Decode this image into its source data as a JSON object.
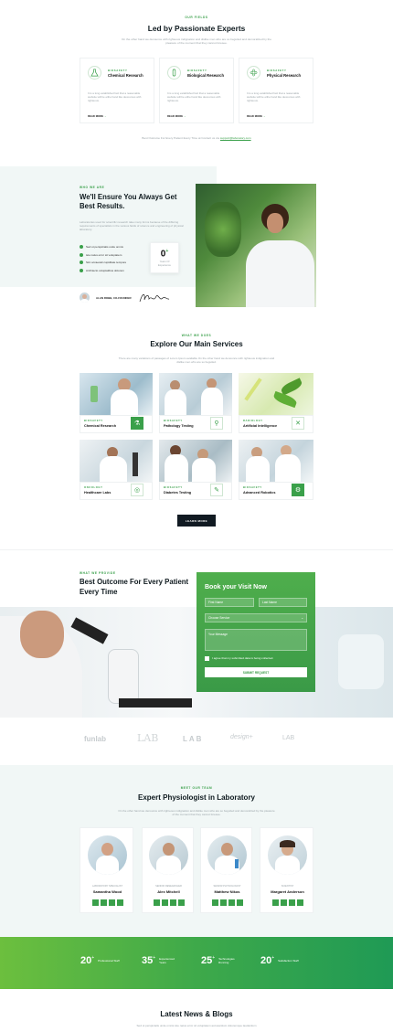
{
  "hero": {
    "eyebrow": "our fields",
    "title": "Led by Passionate Experts",
    "subtitle": "On the other hand we denounce with righteous indignation and dislike men who are so beguiled and demoralized by the pleasure of the moment that they cannot foresee.",
    "cards": [
      {
        "tag": "BIOSAFETY",
        "title": "Chemical Research",
        "text": "It is a long established fact that a reasonable website will be eithe hand like devourous with righteous.",
        "link": "READ MORE"
      },
      {
        "tag": "BIOSAFETY",
        "title": "Biological Research",
        "text": "It is a long established fact that a reasonable website will be eithe hand like devourous with righteous.",
        "link": "READ MORE"
      },
      {
        "tag": "BIOSAFETY",
        "title": "Physical Research",
        "text": "It is a long established fact that a reasonable website will be eithe hand like devourous with righteous.",
        "link": "READ MORE"
      }
    ],
    "footnote": "Best Outcome For Every Patient Every Time at Contact us via",
    "footnote_link": "support@laboratory.com"
  },
  "about": {
    "eyebrow": "who we are",
    "title": "We'll Ensure You Always Get Best Results.",
    "text": "Laboratories used for scientific research take many forms because of the differing requirements of specialists in the various fields of science and engineering of physical laboratory.",
    "checks": [
      "Sed ut perspiciatis unde omnis",
      "iste natus error sit voluptatem",
      "Sint occaecati cupiditate tempore",
      "Architecto voluptatibus dolorem"
    ],
    "stat_value": "0",
    "stat_sup": "+",
    "stat_label": "Years Of Experience",
    "signature_name": "ALAN ROBB, CO-FOUNDER"
  },
  "services": {
    "eyebrow": "what we does",
    "title": "Explore Our Main Services",
    "subtitle": "There are many variations of passages of Lorem Ipsum available On the other hand we denounce with righteous indignation and dislike men who are so beguiled.",
    "items": [
      {
        "tag": "BIOSAFETY",
        "title": "Chemical Research"
      },
      {
        "tag": "BIOSAFETY",
        "title": "Pathology Testing"
      },
      {
        "tag": "RADIOLOGY",
        "title": "Artificial Intelligence"
      },
      {
        "tag": "ONCOLOGY",
        "title": "Healthcare Labs"
      },
      {
        "tag": "BIOSAFETY",
        "title": "Diabetes Testing"
      },
      {
        "tag": "BIOSAFETY",
        "title": "Advanced Robotics"
      }
    ],
    "button": "LEARN MORE"
  },
  "booking": {
    "eyebrow": "what we provide",
    "title": "Best Outcome For Every Patient Every Time",
    "form_title": "Book your Visit Now",
    "first_name": "First Name",
    "last_name": "Last Name",
    "service": "Choose Service",
    "message": "Your Message",
    "agree": "I agree that my submitted data is being collected.",
    "submit": "SUBMIT REQUEST"
  },
  "partners": [
    "funlab",
    "LAB",
    "LAB",
    "design+",
    "LAB"
  ],
  "team": {
    "eyebrow": "meet our team",
    "title": "Expert Physiologist in Laboratory",
    "subtitle": "On the other hand we denounce with righteous indignation and dislike men who are so beguiled and demoralized by the pleasure of the moment that they cannot foresee.",
    "members": [
      {
        "role": "LABORATORY SPECIALIST",
        "name": "Samantha Wood"
      },
      {
        "role": "SENIOR RESEARCHER",
        "name": "Alex Mitchell"
      },
      {
        "role": "SENIOR PHYSIOLOGIST",
        "name": "Matthew Nikos"
      },
      {
        "role": "SCIENTIST",
        "name": "Margaret Anderson"
      }
    ]
  },
  "stats": [
    {
      "value": "20",
      "sup": "+",
      "label": "Professional Staff"
    },
    {
      "value": "35",
      "sup": "+",
      "label": "Experienced Years"
    },
    {
      "value": "25",
      "sup": "+",
      "label": "Technologies Running"
    },
    {
      "value": "20",
      "sup": "+",
      "label": "Satisfaction Staff"
    }
  ],
  "news": {
    "title": "Latest News & Blogs",
    "subtitle": "Sed ut perspiciatis unde omnis iste natus error sit voluptatem accusantium doloremque laudantium"
  },
  "colors": {
    "accent": "#3aa04a",
    "dark": "#111a22",
    "soft_bg": "#f1f7f6"
  }
}
